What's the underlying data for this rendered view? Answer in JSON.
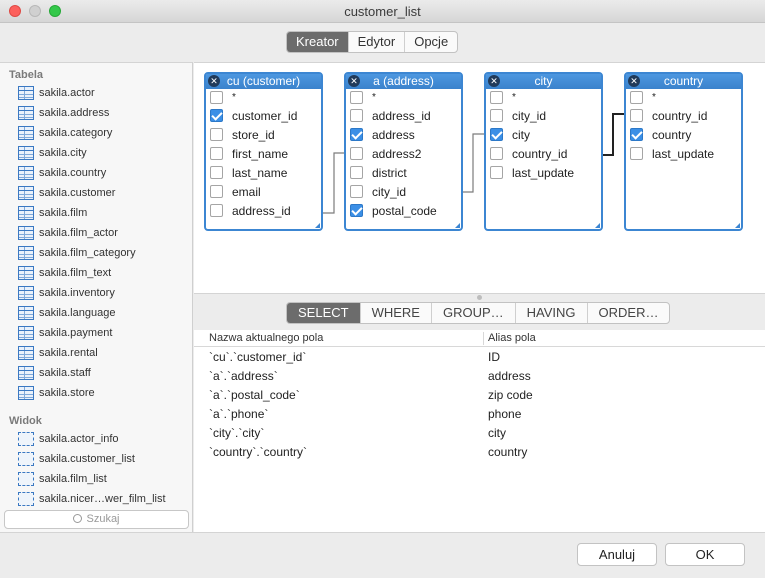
{
  "window": {
    "title": "customer_list"
  },
  "top_tabs": [
    {
      "label": "Kreator",
      "active": true
    },
    {
      "label": "Edytor",
      "active": false
    },
    {
      "label": "Opcje",
      "active": false
    }
  ],
  "sidebar": {
    "tables_header": "Tabela",
    "tables": [
      "sakila.actor",
      "sakila.address",
      "sakila.category",
      "sakila.city",
      "sakila.country",
      "sakila.customer",
      "sakila.film",
      "sakila.film_actor",
      "sakila.film_category",
      "sakila.film_text",
      "sakila.inventory",
      "sakila.language",
      "sakila.payment",
      "sakila.rental",
      "sakila.staff",
      "sakila.store"
    ],
    "views_header": "Widok",
    "views": [
      "sakila.actor_info",
      "sakila.customer_list",
      "sakila.film_list",
      "sakila.nicer…wer_film_list"
    ],
    "search_placeholder": "Szukaj"
  },
  "diagram": {
    "tables": [
      {
        "title": "cu (customer)",
        "fields": [
          {
            "name": "*",
            "checked": false
          },
          {
            "name": "customer_id",
            "checked": true
          },
          {
            "name": "store_id",
            "checked": false
          },
          {
            "name": "first_name",
            "checked": false
          },
          {
            "name": "last_name",
            "checked": false
          },
          {
            "name": "email",
            "checked": false
          },
          {
            "name": "address_id",
            "checked": false
          }
        ]
      },
      {
        "title": "a (address)",
        "fields": [
          {
            "name": "*",
            "checked": false
          },
          {
            "name": "address_id",
            "checked": false
          },
          {
            "name": "address",
            "checked": true
          },
          {
            "name": "address2",
            "checked": false
          },
          {
            "name": "district",
            "checked": false
          },
          {
            "name": "city_id",
            "checked": false
          },
          {
            "name": "postal_code",
            "checked": true
          }
        ]
      },
      {
        "title": "city",
        "fields": [
          {
            "name": "*",
            "checked": false
          },
          {
            "name": "city_id",
            "checked": false
          },
          {
            "name": "city",
            "checked": true
          },
          {
            "name": "country_id",
            "checked": false
          },
          {
            "name": "last_update",
            "checked": false
          }
        ]
      },
      {
        "title": "country",
        "fields": [
          {
            "name": "*",
            "checked": false
          },
          {
            "name": "country_id",
            "checked": false
          },
          {
            "name": "country",
            "checked": true
          },
          {
            "name": "last_update",
            "checked": false
          }
        ]
      }
    ]
  },
  "query_tabs": [
    {
      "label": "SELECT",
      "active": true
    },
    {
      "label": "WHERE",
      "active": false
    },
    {
      "label": "GROUP…",
      "active": false
    },
    {
      "label": "HAVING",
      "active": false
    },
    {
      "label": "ORDER…",
      "active": false
    }
  ],
  "select_grid": {
    "headers": {
      "field": "Nazwa aktualnego pola",
      "alias": "Alias pola"
    },
    "rows": [
      {
        "field": "`cu`.`customer_id`",
        "alias": "ID"
      },
      {
        "field": "`a`.`address`",
        "alias": "address"
      },
      {
        "field": "`a`.`postal_code`",
        "alias": "zip code"
      },
      {
        "field": "`a`.`phone`",
        "alias": "phone"
      },
      {
        "field": "`city`.`city`",
        "alias": "city"
      },
      {
        "field": "`country`.`country`",
        "alias": "country"
      }
    ]
  },
  "footer": {
    "cancel_label": "Anuluj",
    "ok_label": "OK"
  },
  "colors": {
    "accent": "#3c86d2",
    "segment_active": "#6c6c6c",
    "checkbox_on": "#3b8fe6"
  }
}
